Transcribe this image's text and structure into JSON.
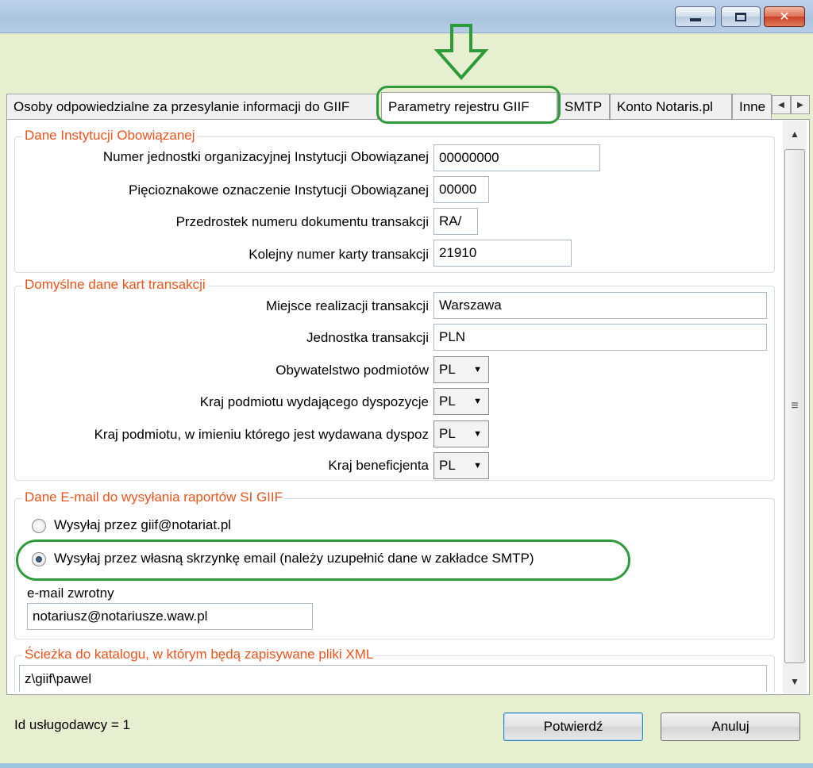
{
  "window": {
    "minimize_icon": "minimize-icon",
    "maximize_icon": "maximize-icon",
    "close_icon": "close-icon"
  },
  "annotation": {
    "arrow_icon": "down-arrow-icon",
    "highlight_color": "#2e9b3b"
  },
  "tabs": [
    {
      "label": "Osoby odpowiedzialne za przesylanie informacji do GIIF"
    },
    {
      "label": "Parametry rejestru GIIF",
      "active": true
    },
    {
      "label": "SMTP"
    },
    {
      "label": "Konto Notaris.pl"
    },
    {
      "label": "Inne"
    }
  ],
  "groups": {
    "institution": {
      "legend": "Dane Instytucji Obowiązanej",
      "unit_number_label": "Numer jednostki organizacyjnej Instytucji Obowiązanej",
      "unit_number_value": "00000000",
      "five_char_label": "Pięcioznakowe oznaczenie Instytucji Obowiązanej",
      "five_char_value": "00000",
      "prefix_label": "Przedrostek numeru dokumentu transakcji",
      "prefix_value": "RA/",
      "next_number_label": "Kolejny numer karty transakcji",
      "next_number_value": "21910"
    },
    "defaults": {
      "legend": "Domyślne dane kart transakcji",
      "place_label": "Miejsce realizacji transakcji",
      "place_value": "Warszawa",
      "unit_label": "Jednostka transakcji",
      "unit_value": "PLN",
      "citizenship_label": "Obywatelstwo podmiotów",
      "citizenship_value": "PL",
      "issuer_country_label": "Kraj podmiotu wydającego dyspozycje",
      "issuer_country_value": "PL",
      "onbehalf_country_label": "Kraj podmiotu, w imieniu którego jest wydawana dyspoz",
      "onbehalf_country_value": "PL",
      "beneficiary_country_label": "Kraj beneficjenta",
      "beneficiary_country_value": "PL"
    },
    "email": {
      "legend": "Dane E-mail do wysyłania raportów SI GIIF",
      "option1": "Wysyłaj przez giif@notariat.pl",
      "option1_selected": false,
      "option2": "Wysyłaj przez własną skrzynkę email (należy uzupełnić dane w zakładce SMTP)",
      "option2_selected": true,
      "return_label": "e-mail zwrotny",
      "return_value": "notariusz@notariusze.waw.pl"
    },
    "path": {
      "legend": "Ścieżka do katalogu, w którym będą zapisywane pliki XML",
      "value": "z\\giif\\pawel"
    }
  },
  "footer": {
    "provider_id": "Id usługodawcy = 1",
    "confirm_label": "Potwierdź",
    "cancel_label": "Anuluj"
  }
}
